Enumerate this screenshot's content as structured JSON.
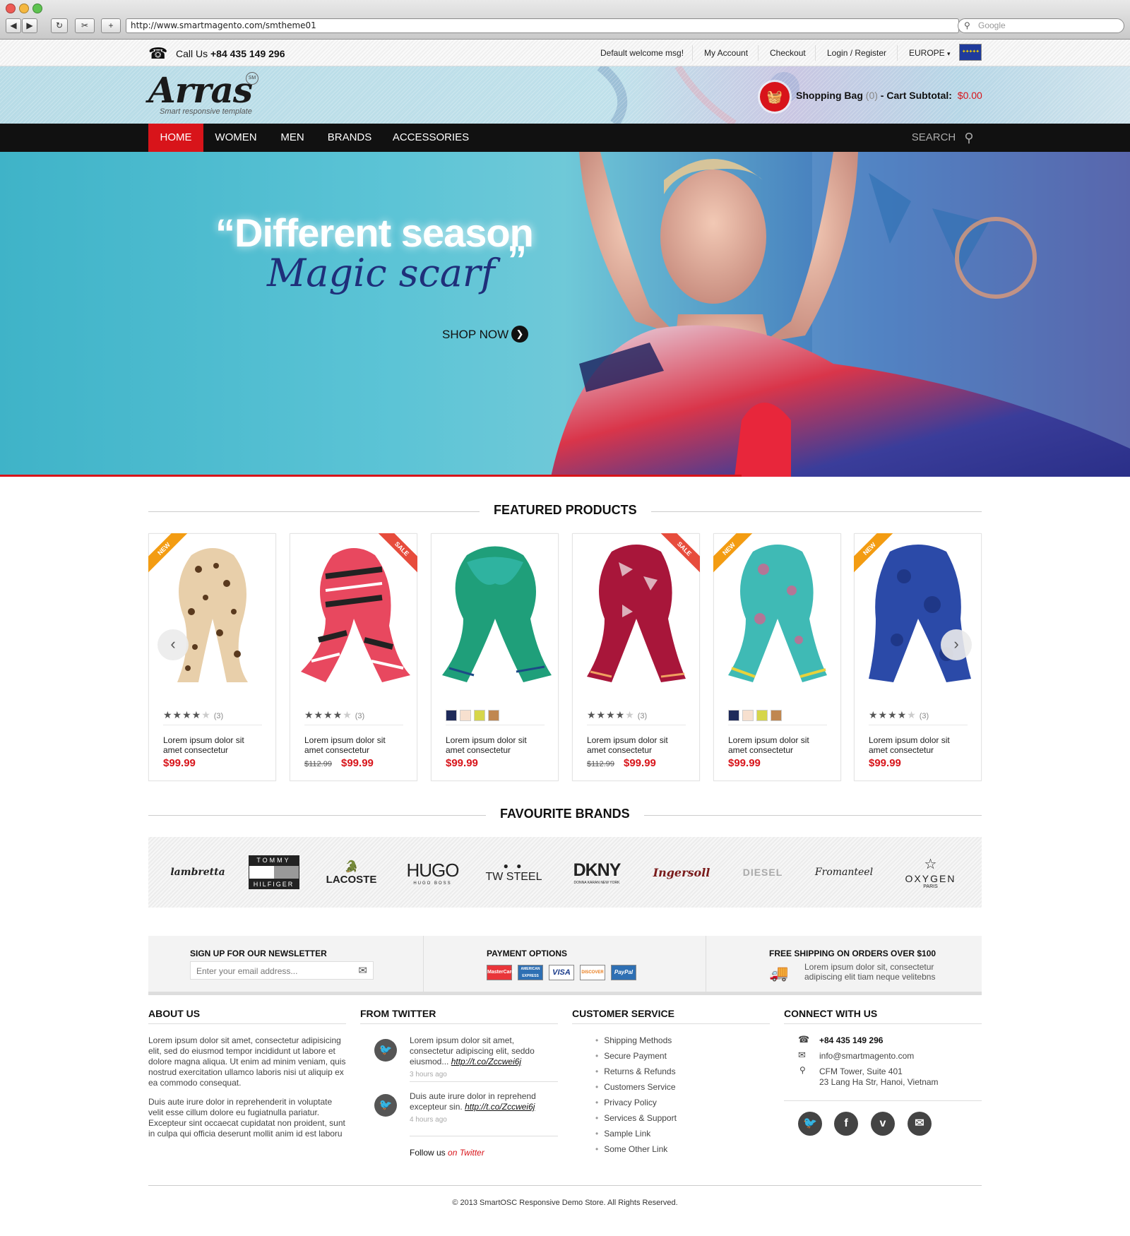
{
  "browser": {
    "url": "http://www.smartmagento.com/smtheme01",
    "search_placeholder": "Google"
  },
  "topbar": {
    "call_label": "Call Us",
    "phone": "+84 435 149 296",
    "links": [
      "Default welcome msg!",
      "My Account",
      "Checkout",
      "Login / Register"
    ],
    "region": "EUROPE"
  },
  "header": {
    "logo": "Arras",
    "logo_badge": "SM",
    "tagline": "Smart responsive template",
    "bag_label": "Shopping Bag",
    "bag_count": "(0)",
    "subtotal_label": "- Cart Subtotal:",
    "subtotal_value": "$0.00"
  },
  "nav": {
    "items": [
      "HOME",
      "WOMEN",
      "MEN",
      "BRANDS",
      "ACCESSORIES"
    ],
    "search_label": "SEARCH"
  },
  "hero": {
    "quote_open": "“",
    "headline": "Different season",
    "script": "Magic scarf",
    "quote_close": "”",
    "cta": "SHOP NOW"
  },
  "featured": {
    "title": "FEATURED PRODUCTS",
    "products": [
      {
        "badge": "NEW",
        "rating": "(3)",
        "name": "Lorem ipsum dolor sit amet consectetur",
        "old_price": "",
        "price": "$99.99"
      },
      {
        "badge": "SALE",
        "rating": "(3)",
        "name": "Lorem ipsum dolor sit amet consectetur",
        "old_price": "$112.99",
        "price": "$99.99"
      },
      {
        "badge": "",
        "rating": "",
        "name": "Lorem ipsum dolor sit amet consectetur",
        "old_price": "",
        "price": "$99.99"
      },
      {
        "badge": "SALE",
        "rating": "(3)",
        "name": "Lorem ipsum dolor sit amet consectetur",
        "old_price": "$112.99",
        "price": "$99.99"
      },
      {
        "badge": "NEW",
        "rating": "",
        "name": "Lorem ipsum dolor sit amet consectetur",
        "old_price": "",
        "price": "$99.99"
      },
      {
        "badge": "NEW",
        "rating": "(3)",
        "name": "Lorem ipsum dolor sit amet consectetur",
        "old_price": "",
        "price": "$99.99"
      }
    ]
  },
  "brands": {
    "title": "FAVOURITE BRANDS",
    "items": [
      "lambretta",
      "TOMMY",
      "HILFIGER",
      "LACOSTE",
      "HUGO",
      "HUGO BOSS",
      "TW STEEL",
      "DKNY",
      "DONNA KARAN NEW YORK",
      "Ingersoll",
      "DIESEL",
      "Fromanteel",
      "OXYGEN",
      "PARIS"
    ]
  },
  "newsletter": {
    "title": "SIGN UP FOR OUR NEWSLETTER",
    "placeholder": "Enter your email address..."
  },
  "payment": {
    "title": "PAYMENT OPTIONS",
    "cards": [
      "MasterCard",
      "AMERICAN EXPRESS",
      "VISA",
      "DISCOVER",
      "PayPal"
    ]
  },
  "shipping": {
    "title": "FREE SHIPPING ON ORDERS OVER $100",
    "line1": "Lorem ipsum dolor sit, consectetur",
    "line2": "adipiscing elit tiam neque velitebns"
  },
  "about": {
    "title": "ABOUT US",
    "p1": [
      "Lorem ipsum dolor sit amet, consectetur adipisicing",
      "elit, sed do eiusmod tempor incididunt ut labore et",
      "dolore magna aliqua. Ut enim ad minim veniam, quis",
      "nostrud exercitation ullamco laboris nisi ut aliquip ex",
      "ea commodo consequat."
    ],
    "p2": [
      "Duis aute irure dolor in reprehenderit in voluptate",
      "velit esse cillum dolore eu fugiatnulla pariatur.",
      "Excepteur sint occaecat cupidatat non proident, sunt",
      "in culpa qui officia deserunt mollit anim id est laboru"
    ]
  },
  "twitter": {
    "title": "FROM TWITTER",
    "tweet1": {
      "line1": "Lorem ipsum dolor sit amet,",
      "line2": "consectetur adipiscing elit, seddo",
      "line3": "eiusmod...",
      "link": "http://t.co/Zccwei6j",
      "time": "3 hours ago"
    },
    "tweet2": {
      "line1": "Duis aute irure dolor in reprehend",
      "line2": "excepteur sin.",
      "link": "http://t.co/Zccwei6j",
      "time": "4 hours ago"
    },
    "follow_label": "Follow us",
    "follow_link": "on Twitter"
  },
  "customer_service": {
    "title": "CUSTOMER SERVICE",
    "items": [
      "Shipping Methods",
      "Secure Payment",
      "Returns & Refunds",
      "Customers Service",
      "Privacy Policy",
      "Services & Support",
      "Sample Link",
      "Some Other Link"
    ]
  },
  "connect": {
    "title": "CONNECT WITH US",
    "phone": "+84 435 149 296",
    "email": "info@smartmagento.com",
    "address1": "CFM Tower, Suite 401",
    "address2": "23 Lang Ha Str, Hanoi, Vietnam"
  },
  "footer": {
    "copyright": "© 2013 SmartOSC Responsive Demo Store. All Rights Reserved."
  },
  "colors": {
    "accent": "#d8141a",
    "nav_bg": "#111111",
    "badge_new": "#f39c12",
    "badge_sale": "#e74c3c"
  }
}
